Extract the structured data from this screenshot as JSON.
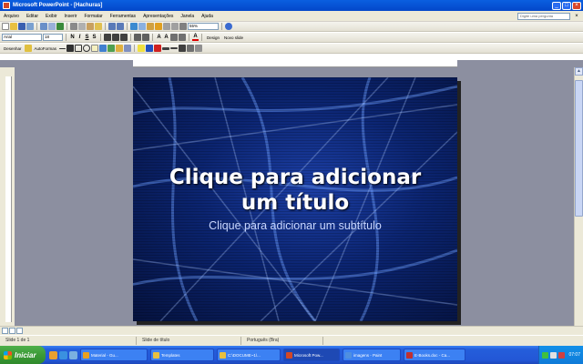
{
  "window": {
    "title": "Microsoft PowerPoint - [Hachuras]"
  },
  "menu": {
    "items": [
      "Arquivo",
      "Editar",
      "Exibir",
      "Inserir",
      "Formatar",
      "Ferramentas",
      "Apresentações",
      "Janela",
      "Ajuda"
    ],
    "help_placeholder": "Digite uma pergunta"
  },
  "toolbar": {
    "zoom": "55%",
    "font": "Arial",
    "size": "18",
    "design_label": "Design",
    "new_slide_label": "Novo slide"
  },
  "drawing_toolbar": {
    "draw_label": "Desenhar",
    "autoshapes_label": "AutoFormas"
  },
  "slide": {
    "title_line1": "Clique para adicionar",
    "title_line2": "um título",
    "subtitle": "Clique para adicionar um subtítulo"
  },
  "status": {
    "slide": "Slide 1 de 1",
    "design": "Slide de título",
    "language": "Português (Bra)"
  },
  "taskbar": {
    "start": "Iniciar",
    "tasks": [
      {
        "label": "Material - Gu...",
        "color": "#e8a020"
      },
      {
        "label": "Templates",
        "color": "#e8c040"
      },
      {
        "label": "C:\\DOCUME~1\\...",
        "color": "#e8c040"
      },
      {
        "label": "Microsoft Pow...",
        "color": "#d24726"
      },
      {
        "label": "imagens - Paint",
        "color": "#4f8fe0"
      },
      {
        "label": "E-Books.doc - Ca...",
        "color": "#c03030"
      }
    ],
    "clock": "07:07"
  }
}
